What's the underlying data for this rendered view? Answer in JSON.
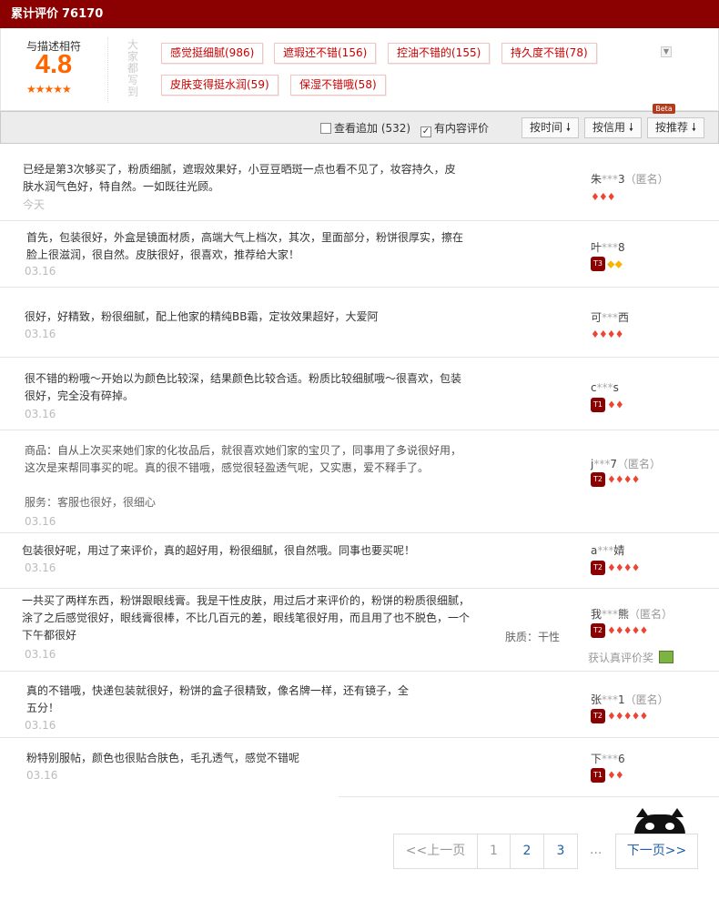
{
  "header": {
    "title": "累计评价",
    "count": "76170"
  },
  "score": {
    "label": "与描述相符",
    "value": "4.8",
    "stars": "★★★★★"
  },
  "tags_label": "大家都写到",
  "tags": [
    "感觉挺细腻(986)",
    "遮瑕还不错(156)",
    "控油不错的(155)",
    "持久度不错(78)",
    "皮肤变得挺水润(59)",
    "保湿不错哦(58)"
  ],
  "filters": {
    "append_label": "查看追加",
    "append_count": "(532)",
    "content_label": "有内容评价",
    "sort_time": "按时间",
    "sort_credit": "按信用",
    "sort_recommend": "按推荐",
    "beta": "Beta"
  },
  "reviews": [
    {
      "content": "已经是第3次够买了，粉质细腻，遮瑕效果好，小豆豆晒斑一点也看不见了，妆容持久，皮肤水润气色好，特自然。一如既往光顾。",
      "date": "今天",
      "user_start": "朱",
      "user_mask": "***",
      "user_end": "3",
      "anon": "（匿名）",
      "hearts": "♦♦♦",
      "badge": ""
    },
    {
      "content": "首先，包装很好，外盒是镜面材质，高端大气上档次，其次，里面部分，粉饼很厚实，擦在脸上很滋润，很自然。皮肤很好，很喜欢，推荐给大家！",
      "date": "03.16",
      "user_start": "叶",
      "user_mask": "***",
      "user_end": "8",
      "anon": "",
      "hearts": "",
      "diamonds": "◆◆",
      "badge": "T3"
    },
    {
      "content": "很好，好精致，粉很细腻，配上他家的精纯BB霜，定妆效果超好，大爱阿",
      "date": "03.16",
      "user_start": "可",
      "user_mask": "***",
      "user_end": "西",
      "anon": "",
      "hearts": "♦♦♦♦",
      "badge": ""
    },
    {
      "content": "很不错的粉哦～开始以为颜色比较深，结果颜色比较合适。粉质比较细腻哦～很喜欢，包装很好，完全没有碎掉。",
      "date": "03.16",
      "user_start": "c",
      "user_mask": "***",
      "user_end": "s",
      "anon": "",
      "hearts": "♦♦",
      "badge": "T1"
    },
    {
      "content": "商品：自从上次买来她们家的化妆品后，就很喜欢她们家的宝贝了，同事用了多说很好用，这次是来帮同事买的呢。真的很不错哦，感觉很轻盈透气呢，又实惠，爱不释手了。",
      "service": "服务：客服也很好，很细心",
      "date": "03.16",
      "user_start": "j",
      "user_mask": "***",
      "user_end": "7",
      "anon": "（匿名）",
      "hearts": "♦♦♦♦",
      "badge": "T2"
    },
    {
      "content": "包装很好呢，用过了来评价，真的超好用，粉很细腻，很自然哦。同事也要买呢！",
      "date": "03.16",
      "user_start": "a",
      "user_mask": "***",
      "user_end": "婧",
      "anon": "",
      "hearts": "♦♦♦♦",
      "badge": "T2"
    },
    {
      "content": "一共买了两样东西，粉饼跟眼线膏。我是干性皮肤，用过后才来评价的，粉饼的粉质很细腻，涂了之后感觉很好，眼线膏很棒，不比几百元的差，眼线笔很好用，而且用了也不脱色，一个下午都很好",
      "date": "03.16",
      "skin": "肤质：干性",
      "user_start": "我",
      "user_mask": "***",
      "user_end": "熊",
      "anon": "（匿名）",
      "hearts": "♦♦♦♦♦",
      "badge": "T2",
      "reward": "获认真评价奖"
    },
    {
      "content": "真的不错哦，快递包装就很好，粉饼的盒子很精致，像名牌一样，还有镜子，全五分！",
      "date": "03.16",
      "user_start": "张",
      "user_mask": "***",
      "user_end": "1",
      "anon": "（匿名）",
      "hearts": "♦♦♦♦♦",
      "badge": "T2"
    },
    {
      "content": "粉特别服帖，颜色也很贴合肤色，毛孔透气，感觉不错呢",
      "date": "03.16",
      "user_start": "下",
      "user_mask": "***",
      "user_end": "6",
      "anon": "",
      "hearts": "♦♦",
      "badge": "T1"
    }
  ],
  "pagination": {
    "prev": "<<上一页",
    "pages": [
      "1",
      "2",
      "3"
    ],
    "ellipsis": "...",
    "next": "下一页>>"
  }
}
